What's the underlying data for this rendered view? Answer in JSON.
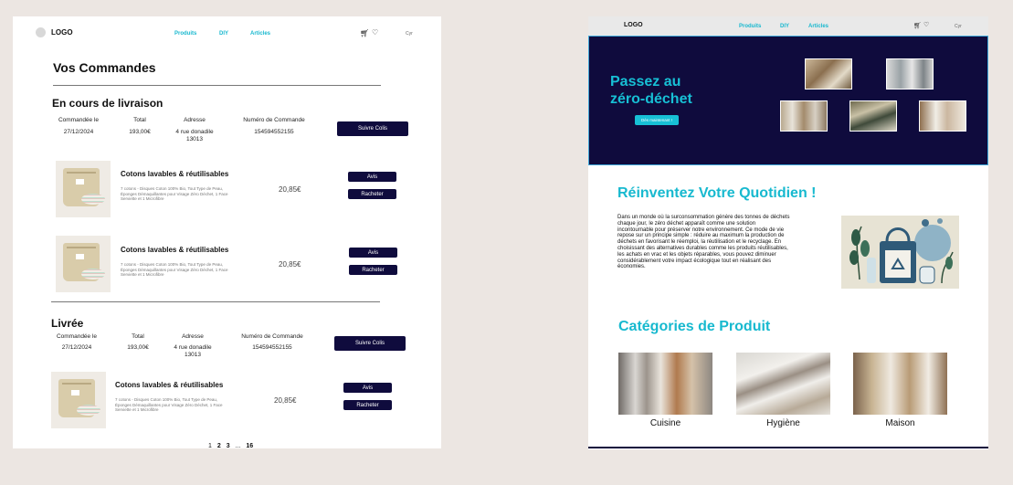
{
  "orders_page": {
    "nav": {
      "logo": "LOGO",
      "links": [
        "Produits",
        "DIY",
        "Articles"
      ],
      "cart_icon": "cart-icon",
      "heart_icon": "heart-icon",
      "account_text": "Cyr"
    },
    "title": "Vos Commandes",
    "in_progress": {
      "title": "En cours de livraison",
      "headers": [
        "Commandée le",
        "Total",
        "Adresse",
        "Numéro de Commande"
      ],
      "date": "27/12/2024",
      "total": "193,00€",
      "address": "4 rue donadile 13013",
      "order_number": "154594552155",
      "track_button": "Suivre Colis",
      "items": [
        {
          "name": "Cotons lavables & réutilisables",
          "description": "7 cotons - Disques Coton 100% Bio, Tout Type de Peau, Éponges Démaquillantes pour Visage Zéro Déchet, 1 Face Serviette et 1 Microfibre",
          "price": "20,85€",
          "review_button": "Avis",
          "rebuy_button": "Racheter"
        },
        {
          "name": "Cotons lavables & réutilisables",
          "description": "7 cotons - Disques Coton 100% Bio, Tout Type de Peau, Éponges Démaquillantes pour Visage Zéro Déchet, 1 Face Serviette et 1 Microfibre",
          "price": "20,85€",
          "review_button": "Avis",
          "rebuy_button": "Racheter"
        }
      ]
    },
    "delivered": {
      "title": "Livrée",
      "headers": [
        "Commandée le",
        "Total",
        "Adresse",
        "Numéro de Commande"
      ],
      "date": "27/12/2024",
      "total": "193,00€",
      "address": "4 rue donadile 13013",
      "order_number": "154594552155",
      "track_button": "Suivre Colis",
      "items": [
        {
          "name": "Cotons lavables & réutilisables",
          "description": "7 cotons - Disques Coton 100% Bio, Tout Type de Peau, Éponges Démaquillantes pour Visage Zéro Déchet, 1 Face Serviette et 1 Microfibre",
          "price": "20,85€",
          "review_button": "Avis",
          "rebuy_button": "Racheter"
        }
      ]
    },
    "pagination": [
      "1",
      "2",
      "3",
      "...",
      "16"
    ]
  },
  "home_page": {
    "nav": {
      "logo": "LOGO",
      "links": [
        "Produits",
        "DIY",
        "Articles"
      ],
      "cart_icon": "cart-icon",
      "heart_icon": "heart-icon",
      "account_text": "Cyr"
    },
    "hero": {
      "title": "Passez au zéro-déchet",
      "button": "Dès maintenant !"
    },
    "intro": {
      "title": "Réinventez Votre Quotidien !",
      "paragraph": "Dans un monde où la surconsommation génère des tonnes de déchets chaque jour, le zéro déchet apparaît comme une solution incontournable pour préserver notre environnement. Ce mode de vie repose sur un principe simple : réduire au maximum la production de déchets en favorisant le réemploi, la réutilisation et le recyclage. En choisissant des alternatives durables comme les produits réutilisables, les achats en vrac et les objets réparables, vous pouvez diminuer considérablement votre impact écologique tout en réalisant des économies."
    },
    "categories": {
      "title": "Catégories de Produit",
      "items": [
        "Cuisine",
        "Hygiène",
        "Maison"
      ]
    }
  },
  "colors": {
    "navy": "#0f0b3d",
    "cyan": "#17c0d5",
    "background": "#ece6e2"
  }
}
